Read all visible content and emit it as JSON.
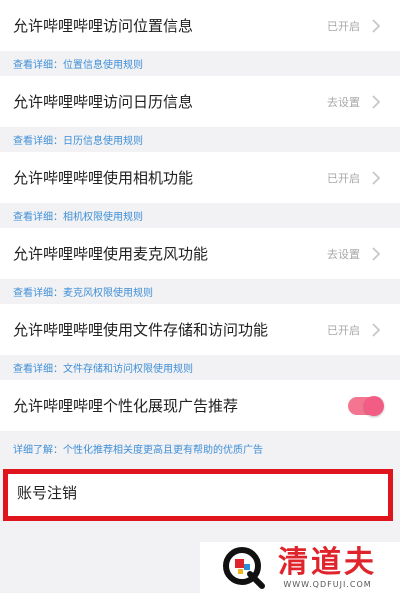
{
  "permissions": [
    {
      "label": "允许哔哩哔哩访问位置信息",
      "status": "已开启",
      "hint_prefix": "查看详细：",
      "hint_link": "位置信息使用规则"
    },
    {
      "label": "允许哔哩哔哩访问日历信息",
      "status": "去设置",
      "hint_prefix": "查看详细：",
      "hint_link": "日历信息使用规则"
    },
    {
      "label": "允许哔哩哔哩使用相机功能",
      "status": "已开启",
      "hint_prefix": "查看详细：",
      "hint_link": "相机权限使用规则"
    },
    {
      "label": "允许哔哩哔哩使用麦克风功能",
      "status": "去设置",
      "hint_prefix": "查看详细：",
      "hint_link": "麦克风权限使用规则"
    },
    {
      "label": "允许哔哩哔哩使用文件存储和访问功能",
      "status": "已开启",
      "hint_prefix": "查看详细：",
      "hint_link": "文件存储和访问权限使用规则"
    }
  ],
  "personalized_ads": {
    "label": "允许哔哩哔哩个性化展现广告推荐",
    "enabled": true,
    "hint": "详细了解：个性化推荐相关度更高且更有帮助的优质广告"
  },
  "account": {
    "label": "账号注销"
  },
  "watermark": {
    "title": "清道夫",
    "url": "WWW.QDFUJI.COM"
  },
  "colors": {
    "accent_pink": "#f25d86",
    "link_blue": "#3f8fd6",
    "highlight_red": "#e0141c"
  }
}
